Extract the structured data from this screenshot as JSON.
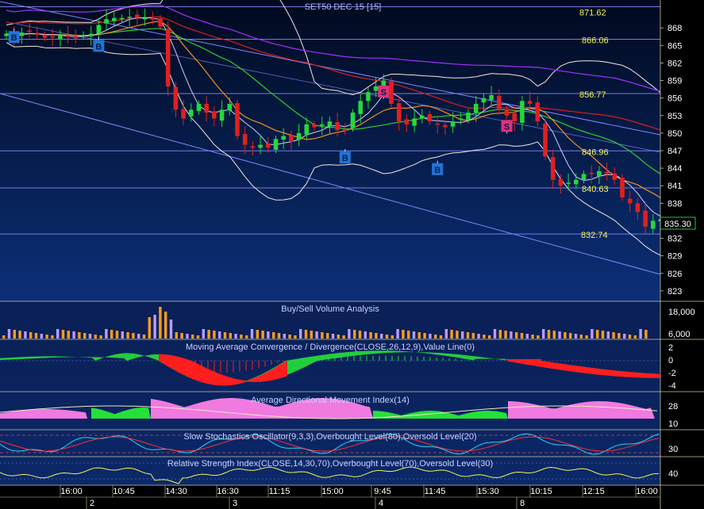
{
  "main": {
    "title": "SET50 DEC 15  [15]",
    "price_axis": [
      868,
      865,
      862,
      859,
      856,
      853,
      850,
      847,
      844,
      841,
      838,
      835,
      832,
      829,
      826,
      823
    ],
    "current_price": "835.30",
    "level_labels": [
      {
        "value": 871.62,
        "text": "871.62"
      },
      {
        "value": 866.06,
        "text": "866.06"
      },
      {
        "value": 856.77,
        "text": "856.77"
      },
      {
        "value": 846.96,
        "text": "846.96"
      },
      {
        "value": 840.63,
        "text": "840.63"
      },
      {
        "value": 832.74,
        "text": "832.74"
      }
    ],
    "signals": [
      {
        "type": "B",
        "x_index": 1,
        "price": 866.5
      },
      {
        "type": "B",
        "x_index": 12,
        "price": 865.0
      },
      {
        "type": "B",
        "x_index": 44,
        "price": 845.9
      },
      {
        "type": "S",
        "x_index": 49,
        "price": 857.2
      },
      {
        "type": "B",
        "x_index": 56,
        "price": 843.9
      },
      {
        "type": "S",
        "x_index": 65,
        "price": 851.3
      }
    ]
  },
  "panels": {
    "volume": {
      "title": "Buy/Sell Volume Analysis",
      "axis": [
        "18,000",
        "6,000"
      ]
    },
    "macd": {
      "title": "Moving Average Convergence / Divergence(CLOSE,26,12,9),Value Line(0)",
      "axis": [
        "2",
        "0",
        "-2",
        "-4"
      ]
    },
    "adx": {
      "title": "Average Directional Movement Index(14)",
      "axis": [
        "28",
        "10"
      ]
    },
    "stoch": {
      "title": "Slow Stochastics Oscillator(9,3,3),Overbought Level(80),Oversold Level(20)",
      "axis": [
        "30"
      ]
    },
    "rsi": {
      "title": "Relative Strength Index(CLOSE,14,30,70),Overbought Level(70),Oversold Level(30)",
      "axis": [
        "40"
      ]
    }
  },
  "time_axis": {
    "times": [
      "16:00",
      "10:45",
      "14:30",
      "16:30",
      "11:15",
      "15:00",
      "9:45",
      "11:45",
      "15:30",
      "10:15",
      "12:15",
      "16:00"
    ],
    "dates": [
      "2",
      "3",
      "4",
      "8"
    ]
  },
  "chart_data": {
    "type": "line",
    "title": "SET50 DEC 15  [15]",
    "candles_close": [
      867.0,
      866.5,
      867.2,
      867.4,
      866.8,
      866.3,
      866.5,
      866.8,
      866.5,
      866.2,
      866.8,
      867.0,
      868.5,
      869.5,
      869.7,
      869.7,
      869.9,
      869.7,
      869.7,
      869.4,
      868.2,
      858.0,
      854.0,
      852.5,
      854.0,
      855.0,
      853.5,
      852.5,
      854.0,
      855.0,
      849.5,
      848.0,
      847.5,
      848.0,
      847.5,
      849.0,
      849.5,
      848.5,
      850.0,
      851.5,
      851.0,
      851.5,
      852.0,
      850.5,
      850.5,
      853.5,
      855.5,
      857.0,
      858.0,
      859.0,
      855.0,
      852.0,
      851.5,
      852.5,
      853.0,
      852.0,
      851.5,
      851.0,
      852.0,
      852.5,
      853.5,
      855.0,
      856.0,
      856.5,
      854.0,
      853.0,
      852.0,
      855.5,
      855.0,
      852.0,
      846.0,
      842.0,
      841.0,
      841.5,
      842.0,
      843.0,
      843.0,
      843.5,
      843.0,
      842.0,
      839.0,
      838.0,
      836.5,
      834.0,
      835.0,
      835.3
    ],
    "reference_levels": [
      871.62,
      866.06,
      856.77,
      846.96,
      840.63,
      832.74
    ],
    "ylim": [
      821.5,
      872.5
    ]
  }
}
